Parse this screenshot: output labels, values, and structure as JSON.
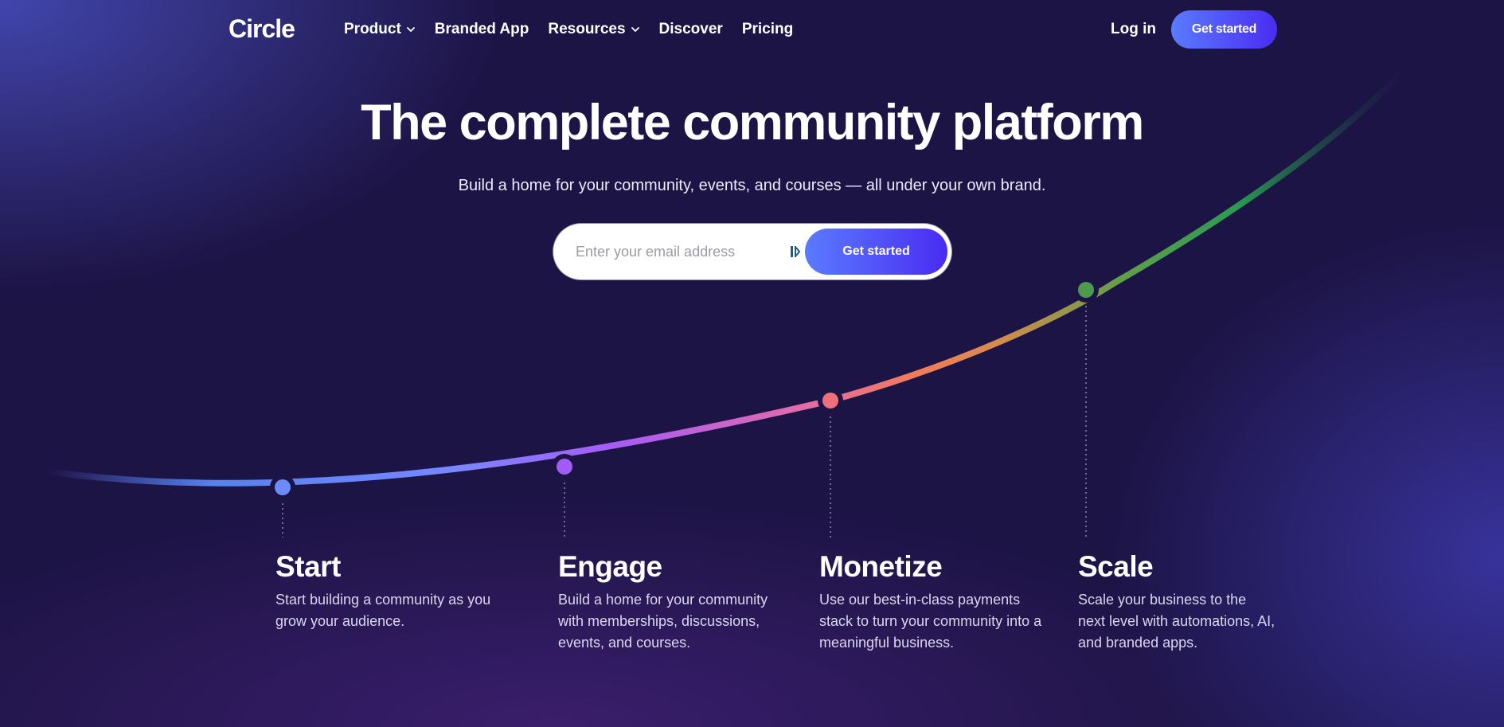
{
  "nav": {
    "logo": "Circle",
    "links": [
      {
        "label": "Product",
        "dropdown": true
      },
      {
        "label": "Branded App",
        "dropdown": false
      },
      {
        "label": "Resources",
        "dropdown": true
      },
      {
        "label": "Discover",
        "dropdown": false
      },
      {
        "label": "Pricing",
        "dropdown": false
      }
    ],
    "login_label": "Log in",
    "cta_label": "Get started"
  },
  "hero": {
    "title": "The complete community platform",
    "subtitle": "Build a home for your community, events, and courses — all under your own brand.",
    "email_placeholder": "Enter your email address",
    "cta_label": "Get started"
  },
  "steps": [
    {
      "title": "Start",
      "description": "Start building a community as you grow your audience.",
      "dot_color": "#6a8cff"
    },
    {
      "title": "Engage",
      "description": "Build a home for your community with memberships, discussions, events, and courses.",
      "dot_color": "#a05cf5"
    },
    {
      "title": "Monetize",
      "description": "Use our best-in-class payments stack to turn your community into a meaningful business.",
      "dot_color": "#f0707a"
    },
    {
      "title": "Scale",
      "description": "Scale your business to the next level with automations, AI, and branded apps.",
      "dot_color": "#4e9a4e"
    }
  ],
  "colors": {
    "background": "#1d1446",
    "accent_start": "#5a7bff",
    "accent_end": "#4a2cf2"
  }
}
